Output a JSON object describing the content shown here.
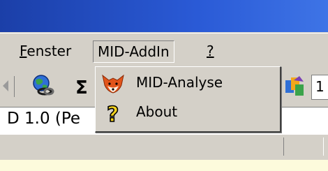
{
  "menubar": {
    "items": [
      {
        "label_first": "F",
        "label_rest": "enster"
      },
      {
        "label": "MID-AddIn"
      },
      {
        "label": "?"
      }
    ]
  },
  "toolbar": {
    "sum_symbol": "Σ",
    "truncated_text": "1"
  },
  "document": {
    "title_fragment": "D 1.0 (Pe"
  },
  "dropdown": {
    "items": [
      {
        "label": "MID-Analyse",
        "icon": "fox-icon"
      },
      {
        "label": "About",
        "icon": "question-mark-icon"
      }
    ]
  }
}
